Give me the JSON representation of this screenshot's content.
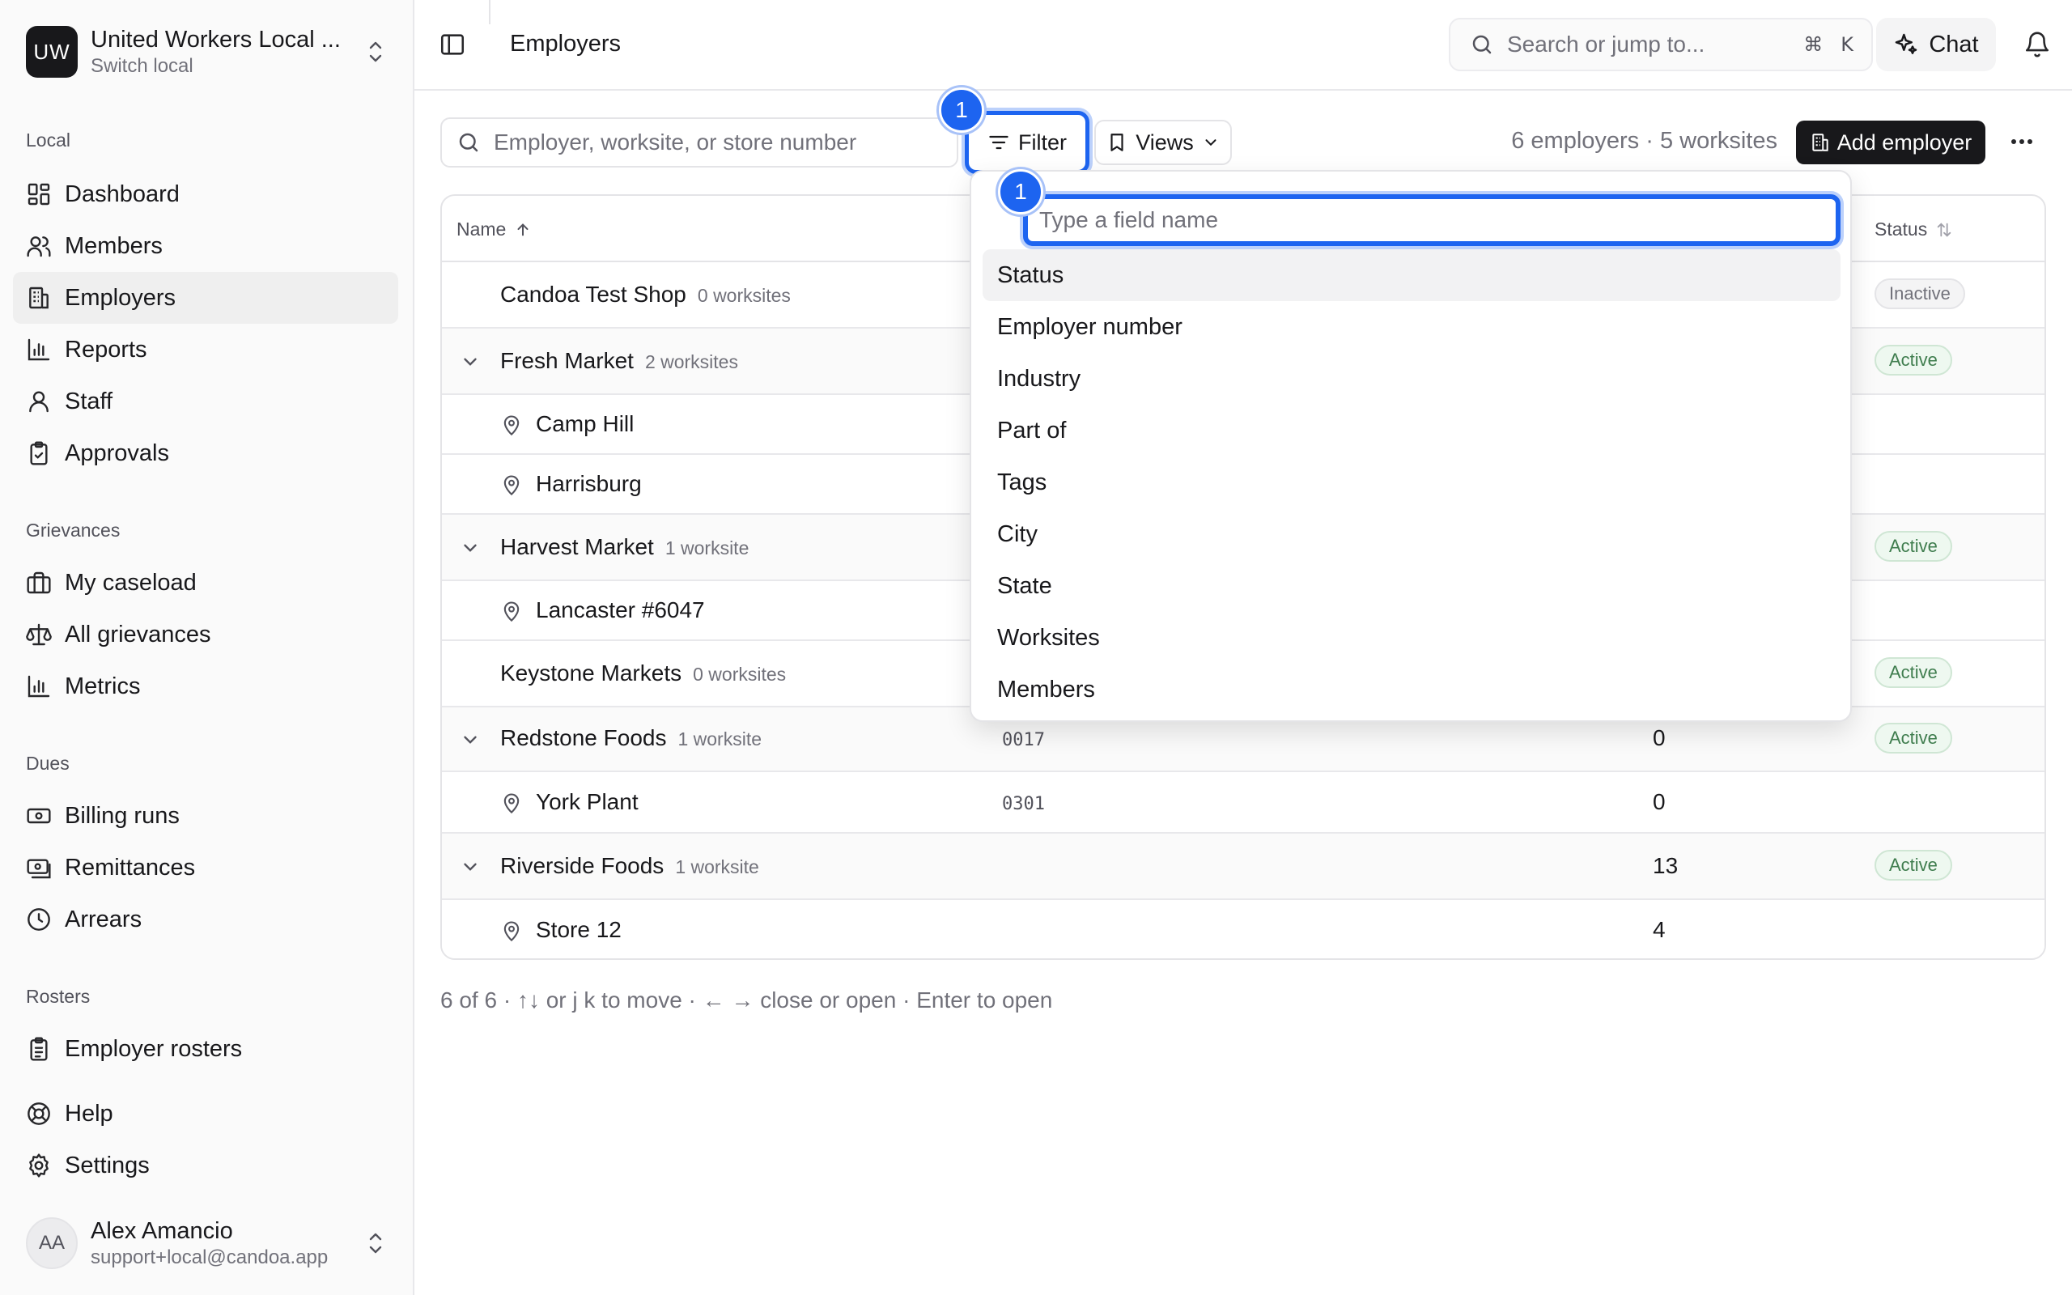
{
  "workspace": {
    "initials": "UW",
    "name": "United Workers Local ...",
    "subtitle": "Switch local"
  },
  "sidebar": {
    "local_heading": "Local",
    "local_items": [
      {
        "label": "Dashboard",
        "icon": "dashboard-icon"
      },
      {
        "label": "Members",
        "icon": "users-icon"
      },
      {
        "label": "Employers",
        "icon": "building-icon",
        "active": true
      },
      {
        "label": "Reports",
        "icon": "bar-chart-icon"
      },
      {
        "label": "Staff",
        "icon": "user-icon"
      },
      {
        "label": "Approvals",
        "icon": "clipboard-check-icon"
      }
    ],
    "grievances_heading": "Grievances",
    "grievance_items": [
      {
        "label": "My caseload",
        "icon": "briefcase-icon"
      },
      {
        "label": "All grievances",
        "icon": "scale-icon"
      },
      {
        "label": "Metrics",
        "icon": "bar-chart-icon"
      }
    ],
    "dues_heading": "Dues",
    "dues_items": [
      {
        "label": "Billing runs",
        "icon": "banknote-icon"
      },
      {
        "label": "Remittances",
        "icon": "receipt-icon"
      },
      {
        "label": "Arrears",
        "icon": "clock-icon"
      }
    ],
    "rosters_heading": "Rosters",
    "roster_items": [
      {
        "label": "Employer rosters",
        "icon": "clipboard-list-icon"
      }
    ],
    "bottom_items": [
      {
        "label": "Help",
        "icon": "lifebuoy-icon"
      },
      {
        "label": "Settings",
        "icon": "gear-icon"
      }
    ]
  },
  "user": {
    "initials": "AA",
    "name": "Alex Amancio",
    "email": "support+local@candoa.app"
  },
  "header": {
    "title": "Employers",
    "search_placeholder": "Search or jump to...",
    "shortcut_cmd": "⌘",
    "shortcut_key": "K",
    "chat_label": "Chat"
  },
  "toolbar": {
    "search_placeholder": "Employer, worksite, or store number",
    "filter_label": "Filter",
    "views_label": "Views",
    "counts": "6 employers · 5 worksites",
    "add_label": "Add employer",
    "filter_badge": "1",
    "input_badge": "1"
  },
  "table": {
    "col_name": "Name",
    "col_status": "Status",
    "rows": [
      {
        "kind": "employer",
        "name": "Candoa Test Shop",
        "worksites": "0 worksites",
        "status": "Inactive",
        "expandable": false
      },
      {
        "kind": "employer",
        "name": "Fresh Market",
        "worksites": "2 worksites",
        "status": "Active",
        "expandable": true
      },
      {
        "kind": "worksite",
        "name": "Camp Hill"
      },
      {
        "kind": "worksite",
        "name": "Harrisburg"
      },
      {
        "kind": "employer",
        "name": "Harvest Market",
        "worksites": "1 worksite",
        "status": "Active",
        "expandable": true
      },
      {
        "kind": "worksite",
        "name": "Lancaster #6047"
      },
      {
        "kind": "employer",
        "name": "Keystone Markets",
        "worksites": "0 worksites",
        "status": "Active",
        "expandable": false
      },
      {
        "kind": "employer",
        "name": "Redstone Foods",
        "worksites": "1 worksite",
        "number": "0017",
        "members": "0",
        "status": "Active",
        "expandable": true
      },
      {
        "kind": "worksite",
        "name": "York Plant",
        "number": "0301",
        "members": "0"
      },
      {
        "kind": "employer",
        "name": "Riverside Foods",
        "worksites": "1 worksite",
        "members": "13",
        "status": "Active",
        "expandable": true
      },
      {
        "kind": "worksite",
        "name": "Store 12",
        "members": "4"
      }
    ]
  },
  "footer_hint": "6 of 6 · ↑↓ or j k to move · ← → close or open · Enter to open",
  "filter_menu": {
    "placeholder": "Type a field name",
    "fields": [
      "Status",
      "Employer number",
      "Industry",
      "Part of",
      "Tags",
      "City",
      "State",
      "Worksites",
      "Members"
    ],
    "highlighted": "Status"
  },
  "colors": {
    "accent": "#1d64f0",
    "active_text": "#3f7d4e",
    "active_bg": "#eef8f0",
    "dark": "#18181b"
  }
}
